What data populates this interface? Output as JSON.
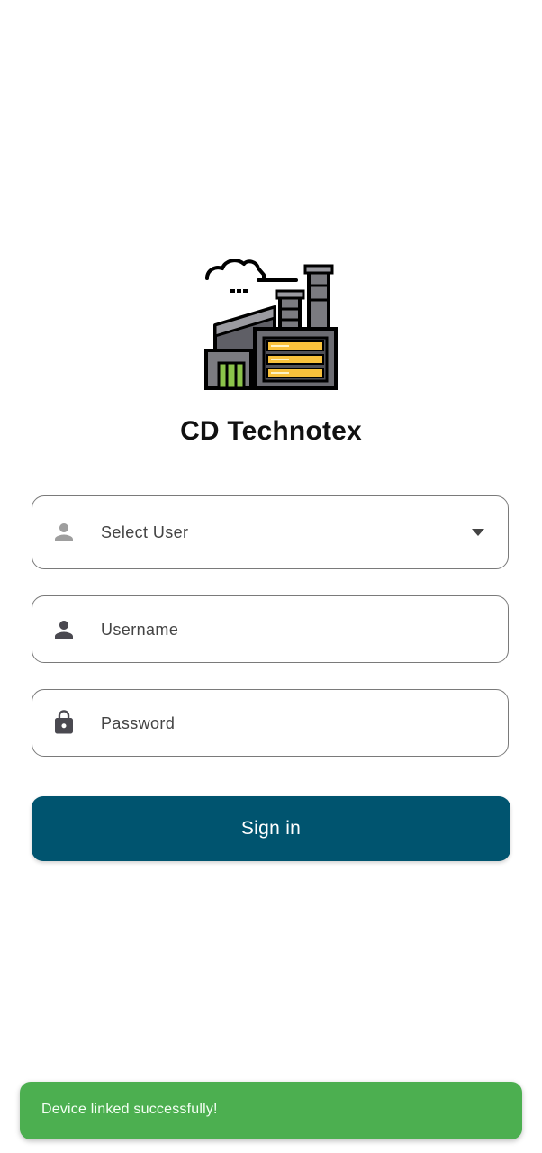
{
  "app": {
    "title": "CD Technotex",
    "logo_icon": "factory-icon"
  },
  "form": {
    "select_user": {
      "placeholder": "Select User",
      "icon": "person-icon",
      "icon_color": "#9e9e9e"
    },
    "username": {
      "placeholder": "Username",
      "icon": "person-icon",
      "icon_color": "#4a4950"
    },
    "password": {
      "placeholder": "Password",
      "icon": "lock-icon",
      "icon_color": "#4a4950"
    },
    "sign_in_label": "Sign in"
  },
  "toast": {
    "message": "Device linked successfully!"
  },
  "colors": {
    "primary": "#00546f",
    "toast_bg": "#4caf50",
    "field_border": "#7a7a7a"
  }
}
